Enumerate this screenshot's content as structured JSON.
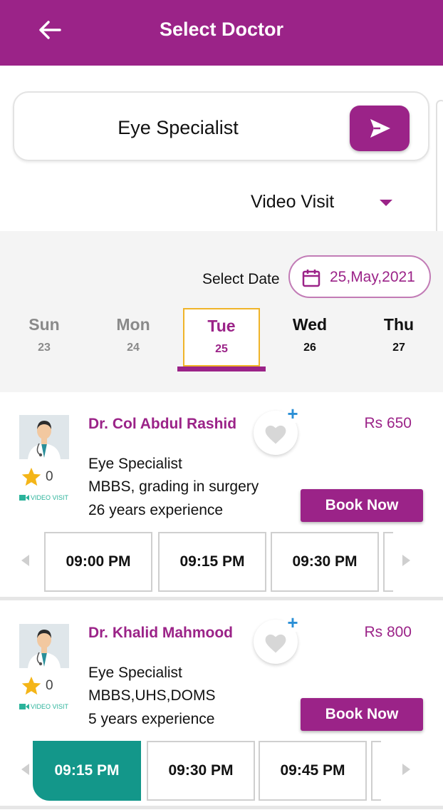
{
  "header": {
    "title": "Select Doctor",
    "back_icon": "arrow-left-icon"
  },
  "search": {
    "value": "Eye Specialist",
    "send_icon": "send-icon"
  },
  "visit_type": {
    "selected": "Video Visit"
  },
  "date_picker": {
    "label": "Select Date",
    "value": "25,May,2021",
    "days": [
      {
        "name": "Sun",
        "num": "23",
        "state": "past"
      },
      {
        "name": "Mon",
        "num": "24",
        "state": "past"
      },
      {
        "name": "Tue",
        "num": "25",
        "state": "selected"
      },
      {
        "name": "Wed",
        "num": "26",
        "state": "future"
      },
      {
        "name": "Thu",
        "num": "27",
        "state": "future"
      }
    ]
  },
  "doctors": [
    {
      "name": "Dr. Col Abdul Rashid",
      "specialty": "Eye Specialist",
      "qualification": "MBBS, grading in surgery",
      "experience": "26 years experience",
      "rating": "0",
      "visit_tag": "VIDEO VISIT",
      "price": "Rs 650",
      "book_label": "Book Now",
      "slots": [
        "09:00 PM",
        "09:15 PM",
        "09:30 PM"
      ],
      "selected_slot": ""
    },
    {
      "name": "Dr. Khalid Mahmood",
      "specialty": "Eye Specialist",
      "qualification": "MBBS,UHS,DOMS",
      "experience": "5 years experience",
      "rating": "0",
      "visit_tag": "VIDEO VISIT",
      "price": "Rs 800",
      "book_label": "Book Now",
      "slots": [
        "09:15 PM",
        "09:30 PM",
        "09:45 PM"
      ],
      "selected_slot": "09:15 PM"
    }
  ],
  "colors": {
    "brand": "#9b2388",
    "accent": "#13978a",
    "selected_border": "#f0b429",
    "plus": "#2b8fd6"
  }
}
